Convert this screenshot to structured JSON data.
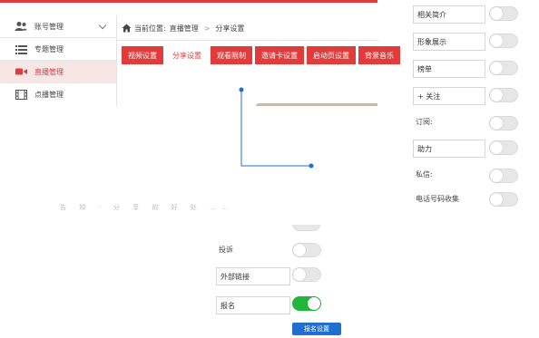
{
  "sidebar": {
    "items": [
      {
        "label": "账号管理",
        "icon": "users-icon",
        "expandable": true
      },
      {
        "label": "专题管理",
        "icon": "list-icon"
      },
      {
        "label": "直播管理",
        "icon": "video-camera-icon",
        "active": true
      },
      {
        "label": "点播管理",
        "icon": "film-icon"
      }
    ]
  },
  "breadcrumb": {
    "prefix": "当前位置:",
    "items": [
      "直播管理",
      "分享设置"
    ],
    "separator": ">"
  },
  "tabs": [
    {
      "label": "视频设置"
    },
    {
      "label": "分享设置",
      "active": true
    },
    {
      "label": "观看限制"
    },
    {
      "label": "邀请卡设置"
    },
    {
      "label": "启动页设置"
    },
    {
      "label": "背景音乐"
    }
  ],
  "faded_text": "告 知 · 分 享 的 好 处 ……",
  "right_panel": {
    "rows": [
      {
        "label": "相关简介",
        "boxed": true,
        "toggle": false
      },
      {
        "label": "形象展示",
        "boxed": true,
        "toggle": false
      },
      {
        "label": "榜单",
        "boxed": true,
        "toggle": false
      },
      {
        "label": "+ 关注",
        "boxed": true,
        "toggle": false
      },
      {
        "label": "订阅:",
        "boxed": false,
        "toggle": false
      },
      {
        "label": "助力",
        "boxed": true,
        "toggle": false
      },
      {
        "label": "私信:",
        "boxed": false,
        "toggle": false
      },
      {
        "label": "电话号码收集",
        "boxed": false,
        "toggle": false
      }
    ]
  },
  "lower_panel": {
    "rows": [
      {
        "label": "投诉",
        "boxed": false,
        "toggle": false
      },
      {
        "label": "外部链接",
        "boxed": true,
        "toggle": false
      },
      {
        "label": "报名",
        "boxed": true,
        "toggle": true
      }
    ],
    "button_label": "报名设置"
  },
  "colors": {
    "accent_red": "#e23b3b",
    "toggle_on": "#1fb63a",
    "button_blue": "#1f6fd1",
    "connector_blue": "#1f6fd1"
  }
}
